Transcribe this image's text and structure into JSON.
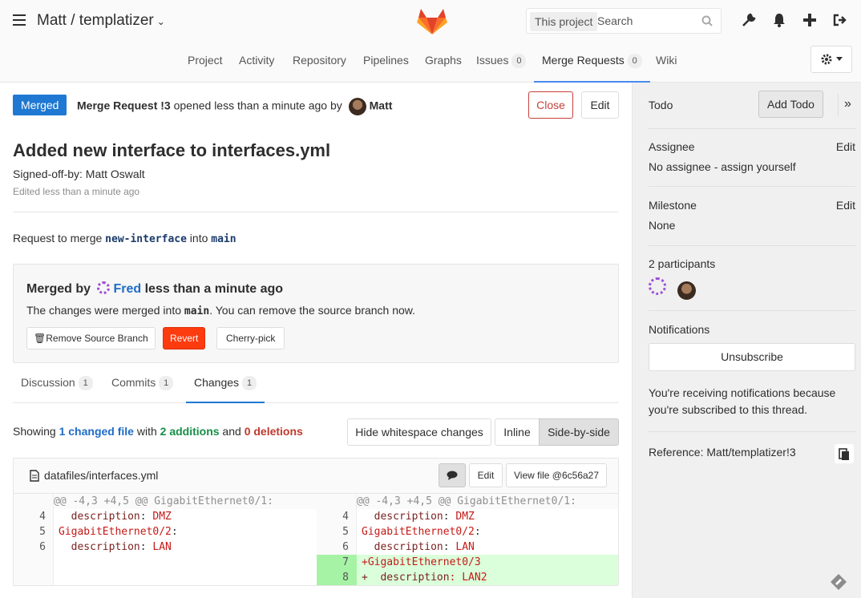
{
  "header": {
    "project": "Matt / templatizer",
    "search_scope": "This project",
    "search_placeholder": "Search"
  },
  "nav": {
    "items": [
      {
        "label": "Project"
      },
      {
        "label": "Activity"
      },
      {
        "label": "Repository"
      },
      {
        "label": "Pipelines"
      },
      {
        "label": "Graphs"
      },
      {
        "label": "Issues",
        "count": "0"
      },
      {
        "label": "Merge Requests",
        "count": "0"
      },
      {
        "label": "Wiki"
      }
    ]
  },
  "mr": {
    "status": "Merged",
    "ref_prefix": "Merge Request !3",
    "ref_suffix": " opened less than a minute ago by",
    "author": "Matt",
    "close_label": "Close",
    "edit_label": "Edit",
    "title": "Added new interface to interfaces.yml",
    "signoff": "Signed-off-by: Matt Oswalt",
    "edited": "Edited less than a minute ago",
    "request_prefix": "Request to merge ",
    "source_branch": "new-interface",
    "request_mid": " into ",
    "target_branch": "main"
  },
  "merged_box": {
    "prefix": "Merged by",
    "by": "Fred",
    "suffix": "less than a minute ago",
    "text_prefix": "The changes were merged into ",
    "text_branch": "main",
    "text_suffix": ". You can remove the source branch now.",
    "remove_label": "Remove Source Branch",
    "revert_label": "Revert",
    "cherry_label": "Cherry-pick"
  },
  "tabs": [
    {
      "label": "Discussion",
      "count": "1"
    },
    {
      "label": "Commits",
      "count": "1"
    },
    {
      "label": "Changes",
      "count": "1"
    }
  ],
  "changes": {
    "showing": "Showing ",
    "changed": "1 changed file",
    "with": " with ",
    "additions": "2 additions",
    "and": " and ",
    "deletions": "0 deletions",
    "hide_ws": "Hide whitespace changes",
    "inline": "Inline",
    "side": "Side-by-side"
  },
  "file": {
    "name": "datafiles/interfaces.yml",
    "edit": "Edit",
    "view": "View file @6c56a27",
    "hunk": "@@ -4,3 +4,5 @@ GigabitEthernet0/1:",
    "left": [
      {
        "n": "4",
        "key": "  description",
        "val": " DMZ"
      },
      {
        "n": "5",
        "key": "GigabitEthernet0/2",
        "val": ":"
      },
      {
        "n": "6",
        "key": "  description",
        "val": " LAN"
      }
    ],
    "right": [
      {
        "n": "4",
        "key": "  description",
        "val": " DMZ"
      },
      {
        "n": "5",
        "key": "GigabitEthernet0/2",
        "val": ":"
      },
      {
        "n": "6",
        "key": "  description",
        "val": " LAN"
      },
      {
        "n": "7",
        "key": "+GigabitEthernet0/3",
        "val": ""
      },
      {
        "n": "8",
        "key": "+  description",
        "val": ": LAN2"
      }
    ]
  },
  "sidebar": {
    "todo": "Todo",
    "add_todo": "Add Todo",
    "assignee": "Assignee",
    "assignee_edit": "Edit",
    "assignee_value": "No assignee - assign yourself",
    "milestone": "Milestone",
    "milestone_edit": "Edit",
    "milestone_value": "None",
    "participants": "2 participants",
    "notifications": "Notifications",
    "unsubscribe": "Unsubscribe",
    "notif_text": "You're receiving notifications because you're subscribed to this thread.",
    "reference": "Reference: Matt/templatizer!3"
  },
  "colors": {
    "merged": "#1f78d1",
    "revert": "#fc3b0f",
    "added_bg": "#dbffdb",
    "added_num_bg": "#a6f3a6"
  }
}
